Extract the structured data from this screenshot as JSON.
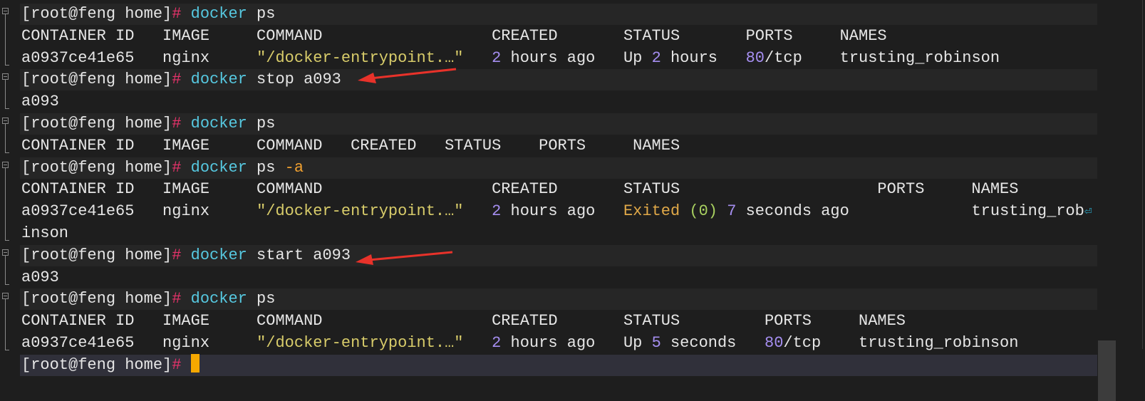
{
  "colors": {
    "text": "#e6e6e6",
    "hash": "#e8336b",
    "cmd": "#56c8e0",
    "num": "#a58ef0",
    "str": "#d8cc6a",
    "flag": "#f0a030",
    "exited": "#e0a848",
    "zero": "#a8d060",
    "cursor": "#f5a800",
    "arrow": "#e8322a"
  },
  "lines": [
    {
      "type": "cmd",
      "segs": [
        [
          "[root@feng home]",
          "text"
        ],
        [
          "#",
          "hash"
        ],
        [
          " ",
          "text"
        ],
        [
          "docker",
          "cmd"
        ],
        [
          " ps",
          "text"
        ]
      ]
    },
    {
      "type": "out",
      "segs": [
        [
          "CONTAINER ID   IMAGE     COMMAND                  CREATED       STATUS       PORTS     NAMES",
          "text"
        ]
      ]
    },
    {
      "type": "out",
      "segs": [
        [
          "a0937ce41e65   nginx     ",
          "text"
        ],
        [
          "\"/docker-entrypoint.…\"",
          "str"
        ],
        [
          "   ",
          "text"
        ],
        [
          "2",
          "num"
        ],
        [
          " hours ago   Up ",
          "text"
        ],
        [
          "2",
          "num"
        ],
        [
          " hours   ",
          "text"
        ],
        [
          "80",
          "num"
        ],
        [
          "/tcp    trusting_robinson",
          "text"
        ]
      ]
    },
    {
      "type": "cmd",
      "segs": [
        [
          "[root@feng home]",
          "text"
        ],
        [
          "#",
          "hash"
        ],
        [
          " ",
          "text"
        ],
        [
          "docker",
          "cmd"
        ],
        [
          " stop a093",
          "text"
        ]
      ]
    },
    {
      "type": "out",
      "segs": [
        [
          "a093",
          "text"
        ]
      ]
    },
    {
      "type": "cmd",
      "segs": [
        [
          "[root@feng home]",
          "text"
        ],
        [
          "#",
          "hash"
        ],
        [
          " ",
          "text"
        ],
        [
          "docker",
          "cmd"
        ],
        [
          " ps",
          "text"
        ]
      ]
    },
    {
      "type": "out",
      "segs": [
        [
          "CONTAINER ID   IMAGE     COMMAND   CREATED   STATUS    PORTS     NAMES",
          "text"
        ]
      ]
    },
    {
      "type": "cmd",
      "segs": [
        [
          "[root@feng home]",
          "text"
        ],
        [
          "#",
          "hash"
        ],
        [
          " ",
          "text"
        ],
        [
          "docker",
          "cmd"
        ],
        [
          " ps ",
          "text"
        ],
        [
          "-a",
          "flag"
        ]
      ]
    },
    {
      "type": "out",
      "segs": [
        [
          "CONTAINER ID   IMAGE     COMMAND                  CREATED       STATUS                     PORTS     NAMES",
          "text"
        ]
      ]
    },
    {
      "type": "out",
      "segs": [
        [
          "a0937ce41e65   nginx     ",
          "text"
        ],
        [
          "\"/docker-entrypoint.…\"",
          "str"
        ],
        [
          "   ",
          "text"
        ],
        [
          "2",
          "num"
        ],
        [
          " hours ago   ",
          "text"
        ],
        [
          "Exited",
          "exited"
        ],
        [
          " ",
          "text"
        ],
        [
          "(0)",
          "zero"
        ],
        [
          " ",
          "text"
        ],
        [
          "7",
          "num"
        ],
        [
          " seconds ago             trusting_rob",
          "text"
        ]
      ],
      "wrap": "⏎"
    },
    {
      "type": "out",
      "segs": [
        [
          "inson",
          "text"
        ]
      ]
    },
    {
      "type": "cmd",
      "segs": [
        [
          "[root@feng home]",
          "text"
        ],
        [
          "#",
          "hash"
        ],
        [
          " ",
          "text"
        ],
        [
          "docker",
          "cmd"
        ],
        [
          " start a093",
          "text"
        ]
      ]
    },
    {
      "type": "out",
      "segs": [
        [
          "a093",
          "text"
        ]
      ]
    },
    {
      "type": "cmd",
      "segs": [
        [
          "[root@feng home]",
          "text"
        ],
        [
          "#",
          "hash"
        ],
        [
          " ",
          "text"
        ],
        [
          "docker",
          "cmd"
        ],
        [
          " ps",
          "text"
        ]
      ]
    },
    {
      "type": "out",
      "segs": [
        [
          "CONTAINER ID   IMAGE     COMMAND                  CREATED       STATUS         PORTS     NAMES",
          "text"
        ]
      ]
    },
    {
      "type": "out",
      "segs": [
        [
          "a0937ce41e65   nginx     ",
          "text"
        ],
        [
          "\"/docker-entrypoint.…\"",
          "str"
        ],
        [
          "   ",
          "text"
        ],
        [
          "2",
          "num"
        ],
        [
          " hours ago   Up ",
          "text"
        ],
        [
          "5",
          "num"
        ],
        [
          " seconds   ",
          "text"
        ],
        [
          "80",
          "num"
        ],
        [
          "/tcp    trusting_robinson",
          "text"
        ]
      ]
    },
    {
      "type": "current",
      "segs": [
        [
          "[root@feng home]",
          "text"
        ],
        [
          "#",
          "hash"
        ],
        [
          " ",
          "text"
        ]
      ],
      "cursor": true
    }
  ]
}
